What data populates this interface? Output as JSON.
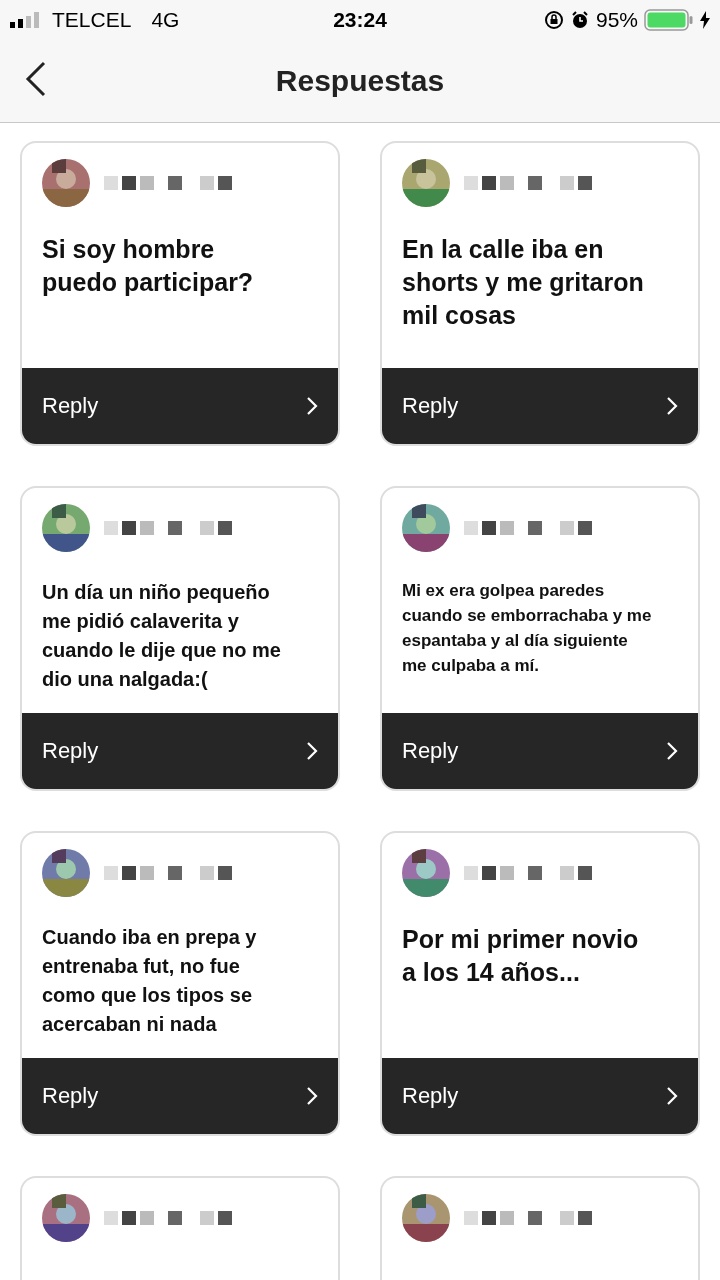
{
  "status_bar": {
    "carrier": "TELCEL",
    "network": "4G",
    "time": "23:24",
    "battery": "95%"
  },
  "header": {
    "title": "Respuestas"
  },
  "cards": [
    {
      "question": "Si soy hombre puedo participar?",
      "action": "Reply"
    },
    {
      "question": "En la calle iba en shorts y me gritaron mil cosas",
      "action": "Reply"
    },
    {
      "question": "Un día un niño pequeño me pidió calaverita y cuando le dije que no me dio una nalgada:(",
      "action": "Reply"
    },
    {
      "question": "Mi ex era golpea paredes cuando se emborrachaba y me espantaba y al día siguiente me culpaba a mí.",
      "action": "Reply"
    },
    {
      "question": "Cuando iba en prepa y entrenaba fut, no fue como que los tipos se acercaban ni nada",
      "action": "Reply"
    },
    {
      "question": "Por mi primer novio a los 14 años...",
      "action": "Reply"
    },
    {
      "kind": "cut_off"
    },
    {
      "kind": "cut_off"
    }
  ]
}
